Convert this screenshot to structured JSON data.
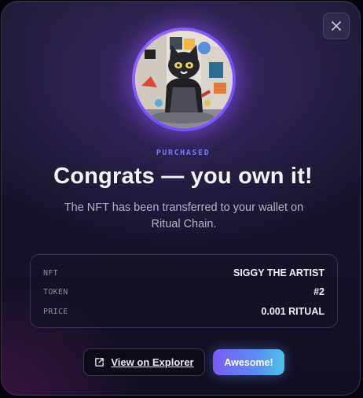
{
  "dialog": {
    "eyebrow": "PURCHASED",
    "title": "Congrats — you own it!",
    "subtitle": "The NFT has been transferred to your wallet on Ritual Chain."
  },
  "details": [
    {
      "label": "NFT",
      "value": "SIGGY THE ARTIST"
    },
    {
      "label": "TOKEN",
      "value": "#2"
    },
    {
      "label": "PRICE",
      "value": "0.001 RITUAL"
    }
  ],
  "actions": {
    "explorer_label": "View on Explorer",
    "explorer_icon": "external-link-icon",
    "confirm_label": "Awesome!"
  },
  "icons": {
    "close": "close-icon",
    "avatar": "nft-artwork"
  },
  "colors": {
    "accent_eyebrow": "#6f7ff0",
    "button_gradient_start": "#7b5cf5",
    "button_gradient_end": "#4cc3e8",
    "avatar_ring": "#8b5cf6"
  }
}
